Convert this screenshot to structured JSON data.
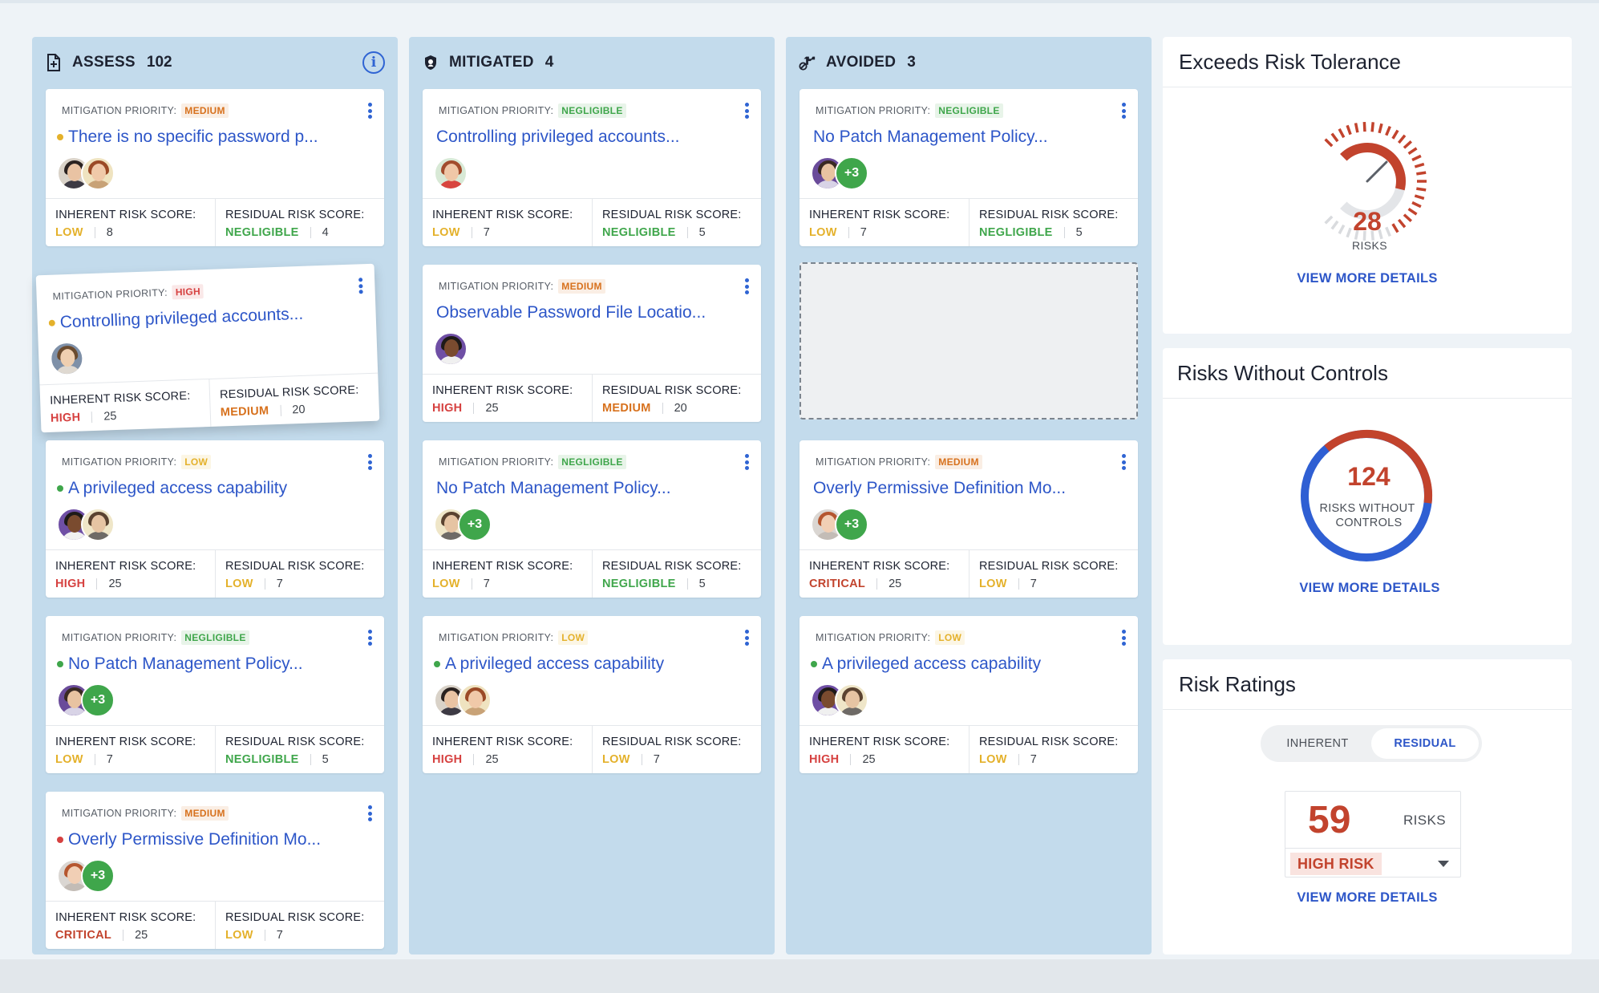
{
  "colors": {
    "critical": "#c2432d",
    "high": "#d64140",
    "medium": "#d7711d",
    "low": "#e4b12b",
    "negligible": "#3fa64b",
    "link": "#2d56c8",
    "column_bg": "#c3dbec"
  },
  "columns": [
    {
      "title": "ASSESS",
      "count": "102",
      "icon": "document-plus-icon",
      "has_info": true,
      "cards": [
        {
          "priority_label": "MITIGATION PRIORITY:",
          "priority": "MEDIUM",
          "priority_level": "medium",
          "dot": "low",
          "title": "There is no specific password p...",
          "avatars": [
            "woman-dark-hair",
            "woman-auburn-hair"
          ],
          "plus": "",
          "inherent_label": "INHERENT RISK SCORE:",
          "inherent_level": "LOW",
          "inherent_key": "low",
          "inherent_score": "8",
          "residual_label": "RESIDUAL RISK SCORE:",
          "residual_level": "NEGLIGIBLE",
          "residual_key": "negligible",
          "residual_score": "4"
        },
        {
          "priority_label": "MITIGATION PRIORITY:",
          "priority": "HIGH",
          "priority_level": "high",
          "dot": "low",
          "title": "Controlling privileged accounts...",
          "avatars": [
            "woman-brown-hair"
          ],
          "plus": "",
          "inherent_label": "INHERENT RISK SCORE:",
          "inherent_level": "HIGH",
          "inherent_key": "high",
          "inherent_score": "25",
          "residual_label": "RESIDUAL RISK SCORE:",
          "residual_level": "MEDIUM",
          "residual_key": "medium",
          "residual_score": "20"
        },
        {
          "priority_label": "MITIGATION PRIORITY:",
          "priority": "LOW",
          "priority_level": "low",
          "dot": "negligible",
          "title": "A privileged access capability",
          "avatars": [
            "man-dark-skin",
            "man-beard"
          ],
          "plus": "",
          "inherent_label": "INHERENT RISK SCORE:",
          "inherent_level": "HIGH",
          "inherent_key": "high",
          "inherent_score": "25",
          "residual_label": "RESIDUAL RISK SCORE:",
          "residual_level": "LOW",
          "residual_key": "low",
          "residual_score": "7"
        },
        {
          "priority_label": "MITIGATION PRIORITY:",
          "priority": "NEGLIGIBLE",
          "priority_level": "negligible",
          "dot": "negligible",
          "title": "No Patch Management Policy...",
          "avatars": [
            "woman-purple-bg"
          ],
          "plus": "+3",
          "inherent_label": "INHERENT RISK SCORE:",
          "inherent_level": "LOW",
          "inherent_key": "low",
          "inherent_score": "7",
          "residual_label": "RESIDUAL RISK SCORE:",
          "residual_level": "NEGLIGIBLE",
          "residual_key": "negligible",
          "residual_score": "5"
        },
        {
          "priority_label": "MITIGATION PRIORITY:",
          "priority": "MEDIUM",
          "priority_level": "medium",
          "dot": "high",
          "title": "Overly Permissive Definition Mo...",
          "avatars": [
            "woman-red-hair"
          ],
          "plus": "+3",
          "inherent_label": "INHERENT RISK SCORE:",
          "inherent_level": "CRITICAL",
          "inherent_key": "critical",
          "inherent_score": "25",
          "residual_label": "RESIDUAL RISK SCORE:",
          "residual_level": "LOW",
          "residual_key": "low",
          "residual_score": "7"
        }
      ]
    },
    {
      "title": "MITIGATED",
      "count": "4",
      "icon": "shield-icon",
      "has_info": false,
      "cards": [
        {
          "priority_label": "MITIGATION PRIORITY:",
          "priority": "NEGLIGIBLE",
          "priority_level": "negligible",
          "dot": "",
          "title": "Controlling privileged accounts...",
          "avatars": [
            "man-red-hair"
          ],
          "plus": "",
          "inherent_label": "INHERENT RISK SCORE:",
          "inherent_level": "LOW",
          "inherent_key": "low",
          "inherent_score": "7",
          "residual_label": "RESIDUAL RISK SCORE:",
          "residual_level": "NEGLIGIBLE",
          "residual_key": "negligible",
          "residual_score": "5"
        },
        {
          "priority_label": "MITIGATION PRIORITY:",
          "priority": "MEDIUM",
          "priority_level": "medium",
          "dot": "",
          "title": "Observable Password File Locatio...",
          "avatars": [
            "man-dark-skin"
          ],
          "plus": "",
          "inherent_label": "INHERENT RISK SCORE:",
          "inherent_level": "HIGH",
          "inherent_key": "high",
          "inherent_score": "25",
          "residual_label": "RESIDUAL RISK SCORE:",
          "residual_level": "MEDIUM",
          "residual_key": "medium",
          "residual_score": "20"
        },
        {
          "priority_label": "MITIGATION PRIORITY:",
          "priority": "NEGLIGIBLE",
          "priority_level": "negligible",
          "dot": "",
          "title": "No Patch Management Policy...",
          "avatars": [
            "man-beard"
          ],
          "plus": "+3",
          "inherent_label": "INHERENT RISK SCORE:",
          "inherent_level": "LOW",
          "inherent_key": "low",
          "inherent_score": "7",
          "residual_label": "RESIDUAL RISK SCORE:",
          "residual_level": "NEGLIGIBLE",
          "residual_key": "negligible",
          "residual_score": "5"
        },
        {
          "priority_label": "MITIGATION PRIORITY:",
          "priority": "LOW",
          "priority_level": "low",
          "dot": "negligible",
          "title": "A privileged access capability",
          "avatars": [
            "woman-dark-hair",
            "woman-auburn-hair"
          ],
          "plus": "",
          "inherent_label": "INHERENT RISK SCORE:",
          "inherent_level": "HIGH",
          "inherent_key": "high",
          "inherent_score": "25",
          "residual_label": "RESIDUAL RISK SCORE:",
          "residual_level": "LOW",
          "residual_key": "low",
          "residual_score": "7"
        }
      ]
    },
    {
      "title": "AVOIDED",
      "count": "3",
      "icon": "avoid-icon",
      "has_info": false,
      "cards": [
        {
          "priority_label": "MITIGATION PRIORITY:",
          "priority": "NEGLIGIBLE",
          "priority_level": "negligible",
          "dot": "",
          "title": "No Patch Management Policy...",
          "avatars": [
            "woman-purple-bg"
          ],
          "plus": "+3",
          "inherent_label": "INHERENT RISK SCORE:",
          "inherent_level": "LOW",
          "inherent_key": "low",
          "inherent_score": "7",
          "residual_label": "RESIDUAL RISK SCORE:",
          "residual_level": "NEGLIGIBLE",
          "residual_key": "negligible",
          "residual_score": "5"
        },
        {
          "priority_label": "MITIGATION PRIORITY:",
          "priority": "MEDIUM",
          "priority_level": "medium",
          "dot": "",
          "title": "Overly Permissive Definition Mo...",
          "avatars": [
            "woman-red-hair"
          ],
          "plus": "+3",
          "inherent_label": "INHERENT RISK SCORE:",
          "inherent_level": "CRITICAL",
          "inherent_key": "critical",
          "inherent_score": "25",
          "residual_label": "RESIDUAL RISK SCORE:",
          "residual_level": "LOW",
          "residual_key": "low",
          "residual_score": "7"
        },
        {
          "priority_label": "MITIGATION PRIORITY:",
          "priority": "LOW",
          "priority_level": "low",
          "dot": "negligible",
          "title": "A privileged access capability",
          "avatars": [
            "man-dark-skin",
            "man-beard"
          ],
          "plus": "",
          "inherent_label": "INHERENT RISK SCORE:",
          "inherent_level": "HIGH",
          "inherent_key": "high",
          "inherent_score": "25",
          "residual_label": "RESIDUAL RISK SCORE:",
          "residual_level": "LOW",
          "residual_key": "low",
          "residual_score": "7"
        }
      ]
    }
  ],
  "panels": {
    "tolerance": {
      "title": "Exceeds Risk Tolerance",
      "value": "28",
      "label": "RISKS",
      "gauge_fraction": 0.55,
      "link": "VIEW MORE DETAILS"
    },
    "controls": {
      "title": "Risks Without Controls",
      "value": "124",
      "label_line1": "RISKS WITHOUT",
      "label_line2": "CONTROLS",
      "ring_fraction_red": 0.38,
      "link": "VIEW MORE DETAILS"
    },
    "ratings": {
      "title": "Risk Ratings",
      "toggle_inherent": "INHERENT",
      "toggle_residual": "RESIDUAL",
      "value": "59",
      "label": "RISKS",
      "selected": "HIGH RISK",
      "link": "VIEW MORE DETAILS"
    }
  }
}
